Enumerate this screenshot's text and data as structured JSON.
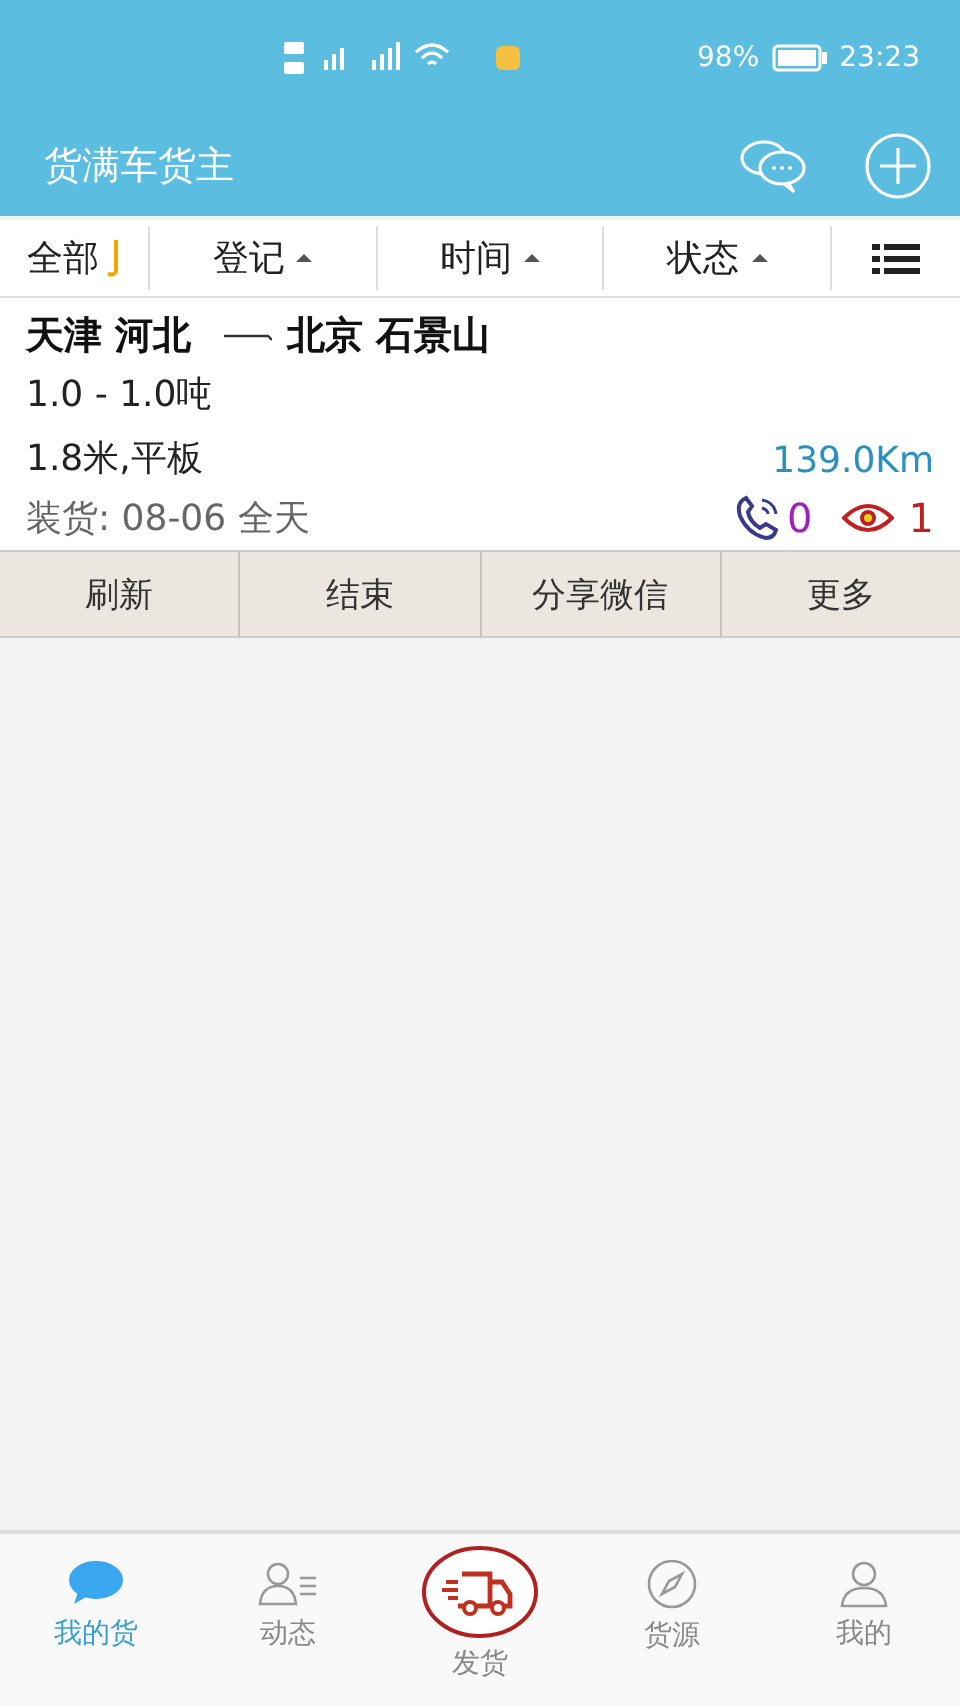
{
  "status_bar": {
    "battery": "98%",
    "time": "23:23"
  },
  "app_bar": {
    "title": "货满车货主"
  },
  "filters": [
    {
      "label": "全部",
      "kind": "dropdown"
    },
    {
      "label": "登记",
      "kind": "sort"
    },
    {
      "label": "时间",
      "kind": "sort"
    },
    {
      "label": "状态",
      "kind": "sort"
    },
    {
      "kind": "menu"
    }
  ],
  "shipments": [
    {
      "from": "天津 河北",
      "to": "北京 石景山",
      "weight": "1.0 - 1.0吨",
      "truck": "1.8米,平板",
      "distance": "139.0Km",
      "loading": "装货:  08-06 全天",
      "calls": "0",
      "views": "1",
      "actions": [
        "刷新",
        "结束",
        "分享微信",
        "更多"
      ]
    }
  ],
  "bottom_nav": [
    {
      "label": "我的货",
      "kind": "chat",
      "selected": true
    },
    {
      "label": "动态",
      "kind": "contacts",
      "selected": false
    },
    {
      "label": "发货",
      "kind": "truck",
      "selected": false
    },
    {
      "label": "货源",
      "kind": "compass",
      "selected": false
    },
    {
      "label": "我的",
      "kind": "person",
      "selected": false
    }
  ]
}
